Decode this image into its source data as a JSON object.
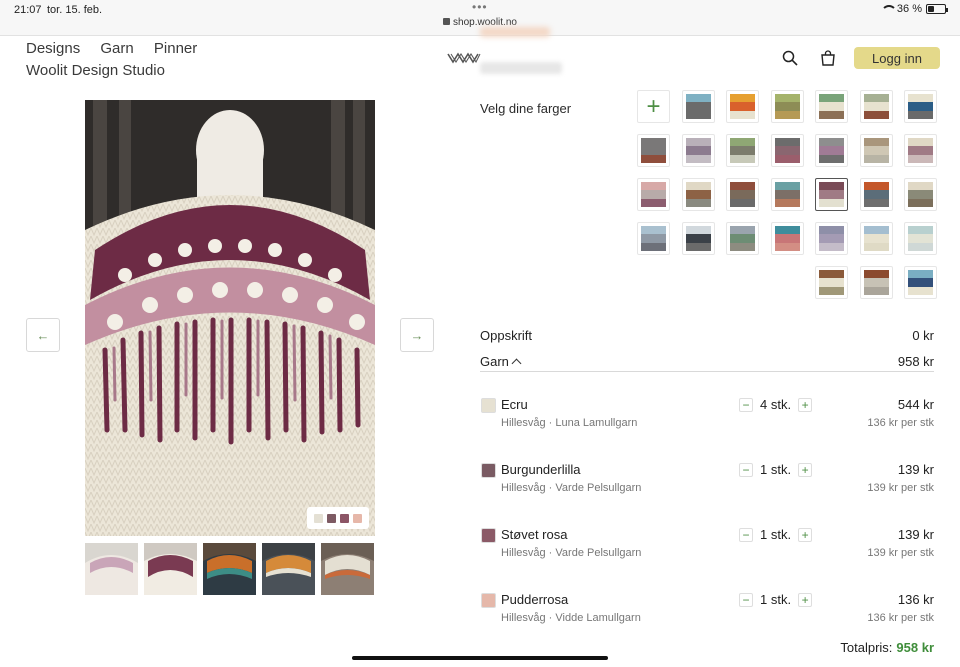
{
  "status_bar": {
    "time": "21:07",
    "date": "tor. 15. feb.",
    "url": "shop.woolit.no",
    "battery": "36 %"
  },
  "nav": {
    "items": [
      "Designs",
      "Garn",
      "Pinner"
    ],
    "studio": "Woolit Design Studio"
  },
  "header": {
    "login_label": "Logg inn"
  },
  "gallery": {
    "dots": [
      "#e4e0d4",
      "#7d5a63",
      "#8c5566",
      "#e6b7a9"
    ],
    "thumb_count": 5
  },
  "picker": {
    "label": "Velg dine farger",
    "rows": [
      [
        [
          "#7fb1c3",
          "#6b6b6b",
          "#6b6b6b"
        ],
        [
          "#e6a031",
          "#d9612c",
          "#e7e2cf"
        ],
        [
          "#a5b36b",
          "#8d8d56",
          "#b59a55"
        ],
        [
          "#7aa47a",
          "#e7e2cf",
          "#8c7056"
        ],
        [
          "#a6b093",
          "#e7e2cf",
          "#8c4f3a"
        ],
        [
          "#e7e2cf",
          "#2b5d86",
          "#6a6a6a"
        ]
      ],
      [
        [
          "#7a7878",
          "#7a7878",
          "#8f4e3c"
        ],
        [
          "#b9b0b9",
          "#8c7b8f",
          "#c3bcc3"
        ],
        [
          "#8fa774",
          "#7c7c6c",
          "#c7c9b8"
        ],
        [
          "#6c6c6c",
          "#8a6670",
          "#9b5e6c"
        ],
        [
          "#8e8e8e",
          "#a07b95",
          "#6e6e6e"
        ],
        [
          "#a9967c",
          "#cfc7b4",
          "#b8b4a5"
        ],
        [
          "#e0d8c5",
          "#a07a85",
          "#cbb8b8"
        ]
      ],
      [
        [
          "#d7a9a7",
          "#b8aba9",
          "#8c5d6f"
        ],
        [
          "#e0d8c5",
          "#8d6245",
          "#8a8a80"
        ],
        [
          "#8f4e3c",
          "#7a6a5b",
          "#6a6a6a"
        ],
        [
          "#6aa0a3",
          "#7c6f67",
          "#b5795d"
        ],
        [
          "#7a4b57",
          "#a07b85",
          "#e3e0d0"
        ],
        [
          "#c4572a",
          "#5b6d79",
          "#6e6e6e"
        ],
        [
          "#e0d8c5",
          "#8a8a78",
          "#7c6f5b"
        ]
      ],
      [
        [
          "#a9c0cf",
          "#8f99a5",
          "#6d7079"
        ],
        [
          "#d1d8dd",
          "#3b4148",
          "#6b6b6b"
        ],
        [
          "#9aa4ae",
          "#6d8d74",
          "#8d8c80"
        ],
        [
          "#3f8d9c",
          "#c87677",
          "#d38e84"
        ],
        [
          "#8e8fa8",
          "#a49bb4",
          "#c4bcc9"
        ],
        [
          "#a4bed0",
          "#e7e2cf",
          "#dfdac5"
        ],
        [
          "#b8d0cf",
          "#e2e3d5",
          "#cfd8d6"
        ]
      ],
      [
        [
          "#8b5a3a",
          "#e7e2cf",
          "#a09878"
        ],
        [
          "#8b4a2e",
          "#c7c2b5",
          "#aaa59a"
        ],
        [
          "#7aaec2",
          "#33507a",
          "#e7e2cf"
        ]
      ]
    ]
  },
  "summary": {
    "pattern_label": "Oppskrift",
    "pattern_price": "0 kr",
    "yarn_label": "Garn",
    "yarn_price": "958 kr"
  },
  "yarns": [
    {
      "name": "Ecru",
      "source": "Hillesvåg · Luna Lamullgarn",
      "qty": "4 stk.",
      "price": "544 kr",
      "unit": "136 kr per stk",
      "color": "#e6e1d2"
    },
    {
      "name": "Burgunderlilla",
      "source": "Hillesvåg · Varde Pelsullgarn",
      "qty": "1 stk.",
      "price": "139 kr",
      "unit": "139 kr per stk",
      "color": "#7a5b63"
    },
    {
      "name": "Støvet rosa",
      "source": "Hillesvåg · Varde Pelsullgarn",
      "qty": "1 stk.",
      "price": "139 kr",
      "unit": "139 kr per stk",
      "color": "#8b5a67"
    },
    {
      "name": "Pudderrosa",
      "source": "Hillesvåg · Vidde Lamullgarn",
      "qty": "1 stk.",
      "price": "136 kr",
      "unit": "136 kr per stk",
      "color": "#e5b8aa"
    }
  ],
  "total": {
    "label": "Totalpris:",
    "value": "958 kr"
  }
}
